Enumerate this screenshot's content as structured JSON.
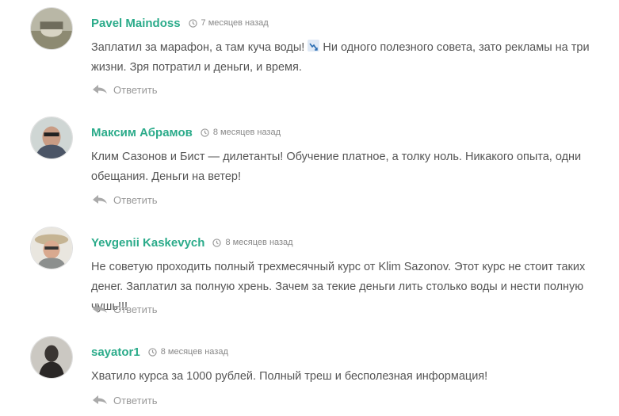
{
  "reply_label": "Ответить",
  "colors": {
    "author": "#2bab8a",
    "meta": "#888888",
    "text": "#555555"
  },
  "comments": [
    {
      "author": "Pavel Maindoss",
      "date": "7 месяцев назад",
      "text_before_emoji": "Заплатил за марафон, а там куча воды! ",
      "emoji": "chart-decreasing-icon",
      "text_after_emoji": " Ни одного полезного совета, зато рекламы на три жизни. Зря потратил и деньги, и время."
    },
    {
      "author": "Максим Абрамов",
      "date": "8 месяцев назад",
      "text": "Клим Сазонов и Бист — дилетанты! Обучение платное, а толку ноль. Никакого опыта, одни обещания. Деньги на ветер!"
    },
    {
      "author": "Yevgenii Kaskevych",
      "date": "8 месяцев назад",
      "text": "Не советую проходить полный трехмесячный курс от Klim Sazonov. Этот курс не стоит таких денег. Заплатил за полную хрень. Зачем за текие деньги лить столько воды и нести полную чушь!!!"
    },
    {
      "author": "sayator1",
      "date": "8 месяцев назад",
      "text": "Хватило курса за 1000 рублей. Полный треш и бесполезная информация!"
    }
  ]
}
